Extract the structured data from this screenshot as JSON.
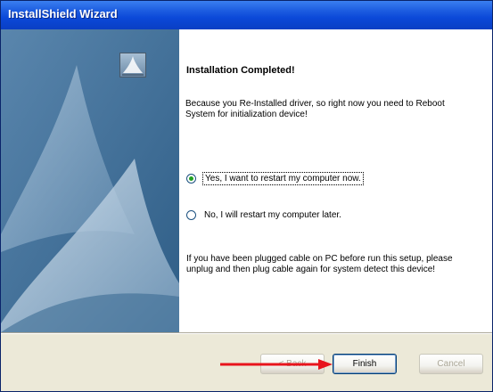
{
  "window": {
    "title": "InstallShield Wizard",
    "title_bar_color": "#0b48d8"
  },
  "main": {
    "heading": "Installation Completed!",
    "description": "Because you Re-Installed driver, so right now you need to Reboot System for initialization device!",
    "options": [
      {
        "label": "Yes, I want to restart my computer now.",
        "selected": true
      },
      {
        "label": "No, I will restart my computer later.",
        "selected": false
      }
    ],
    "note": "If you have been plugged cable on PC before run this setup, please unplug and then plug cable again for system detect this device!"
  },
  "buttons": {
    "back_label": "< Back",
    "finish_label": "Finish",
    "cancel_label": "Cancel"
  },
  "annotation": {
    "arrow_color": "#e8141c",
    "arrow_target": "Finish"
  },
  "icons": {
    "banner": "installshield-sail-graphic",
    "logo": "installshield-logo-icon",
    "arrow": "red-arrow-icon"
  }
}
